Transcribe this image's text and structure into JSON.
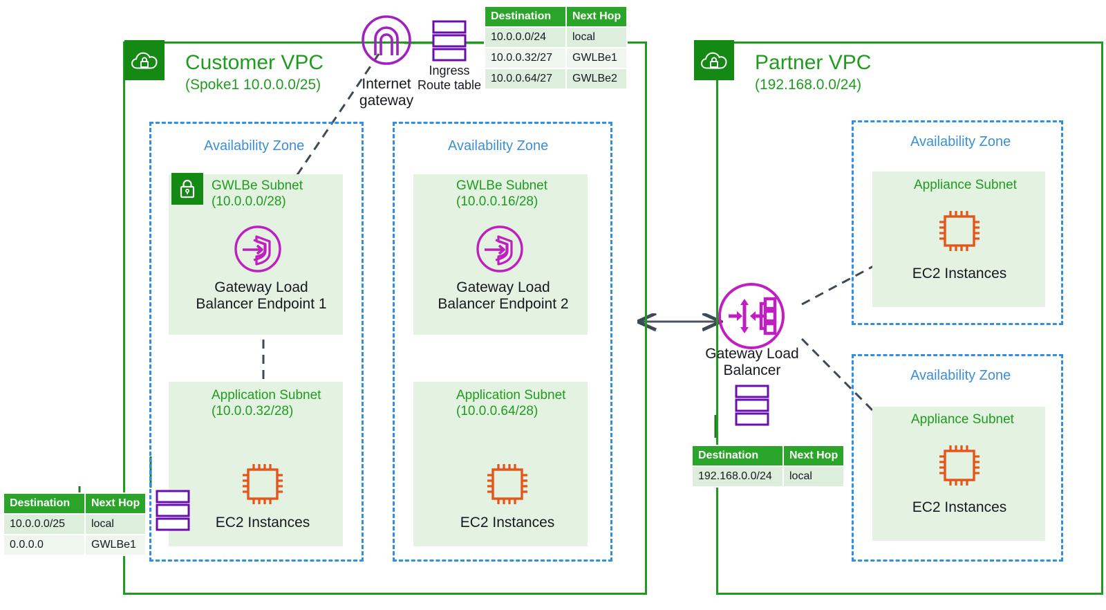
{
  "diagram": {
    "title": "AWS Gateway Load Balancer Endpoint architecture",
    "colors": {
      "vpc_green": "#1f9c1f",
      "vpc_tab_green": "#148a14",
      "az_blue": "#2f8fe0",
      "subnet_fill": "#e3f2e1",
      "purple": "#a020c0",
      "orange": "#e8531a",
      "arrow_gray": "#3d4a55",
      "table_header_green": "#2aa52a"
    }
  },
  "customer_vpc": {
    "icon": "vpc-cloud-lock-icon",
    "title": "Customer VPC",
    "cidr": "(Spoke1 10.0.0.0/25)",
    "az1": {
      "label": "Availability Zone",
      "gwlbe_subnet": {
        "icon": "subnet-lock-icon",
        "name": "GWLBe Subnet",
        "cidr": "(10.0.0.0/28)",
        "endpoint_icon": "gateway-load-balancer-endpoint-icon",
        "endpoint_label_line1": "Gateway Load",
        "endpoint_label_line2": "Balancer Endpoint 1"
      },
      "app_subnet": {
        "name": "Application Subnet",
        "cidr": "(10.0.0.32/28)",
        "instance_icon": "ec2-instance-icon",
        "instance_label": "EC2 Instances"
      }
    },
    "az2": {
      "label": "Availability Zone",
      "gwlbe_subnet": {
        "name": "GWLBe Subnet",
        "cidr": "(10.0.0.16/28)",
        "endpoint_icon": "gateway-load-balancer-endpoint-icon",
        "endpoint_label_line1": "Gateway Load",
        "endpoint_label_line2": "Balancer Endpoint 2"
      },
      "app_subnet": {
        "name": "Application Subnet",
        "cidr": "(10.0.0.64/28)",
        "instance_icon": "ec2-instance-icon",
        "instance_label": "EC2 Instances"
      }
    }
  },
  "partner_vpc": {
    "icon": "vpc-cloud-lock-icon",
    "title": "Partner VPC",
    "cidr": "(192.168.0.0/24)",
    "gwlb": {
      "icon": "gateway-load-balancer-icon",
      "label_line1": "Gateway Load",
      "label_line2": "Balancer",
      "route_table_icon": "route-table-icon"
    },
    "az1": {
      "label": "Availability Zone",
      "appliance_subnet": {
        "name": "Appliance Subnet",
        "instance_icon": "ec2-instance-icon",
        "instance_label": "EC2 Instances"
      }
    },
    "az2": {
      "label": "Availability Zone",
      "appliance_subnet": {
        "name": "Appliance Subnet",
        "instance_icon": "ec2-instance-icon",
        "instance_label": "EC2 Instances"
      }
    }
  },
  "internet_gateway": {
    "icon": "internet-gateway-icon",
    "label_line1": "Internet",
    "label_line2": "gateway"
  },
  "ingress_route_table_icon": {
    "icon": "route-table-icon",
    "label_line1": "Ingress",
    "label_line2": "Route table"
  },
  "app_route_table_icon": {
    "icon": "route-table-icon"
  },
  "ingress_route_table": {
    "headers": [
      "Destination",
      "Next Hop"
    ],
    "rows": [
      [
        "10.0.0.0/24",
        "local"
      ],
      [
        "10.0.0.32/27",
        "GWLBe1"
      ],
      [
        "10.0.0.64/27",
        "GWLBe2"
      ]
    ]
  },
  "application_route_table": {
    "headers": [
      "Destination",
      "Next Hop"
    ],
    "rows": [
      [
        "10.0.0.0/25",
        "local"
      ],
      [
        "0.0.0.0",
        "GWLBe1"
      ]
    ]
  },
  "partner_route_table": {
    "headers": [
      "Destination",
      "Next Hop"
    ],
    "rows": [
      [
        "192.168.0.0/24",
        "local"
      ]
    ]
  }
}
